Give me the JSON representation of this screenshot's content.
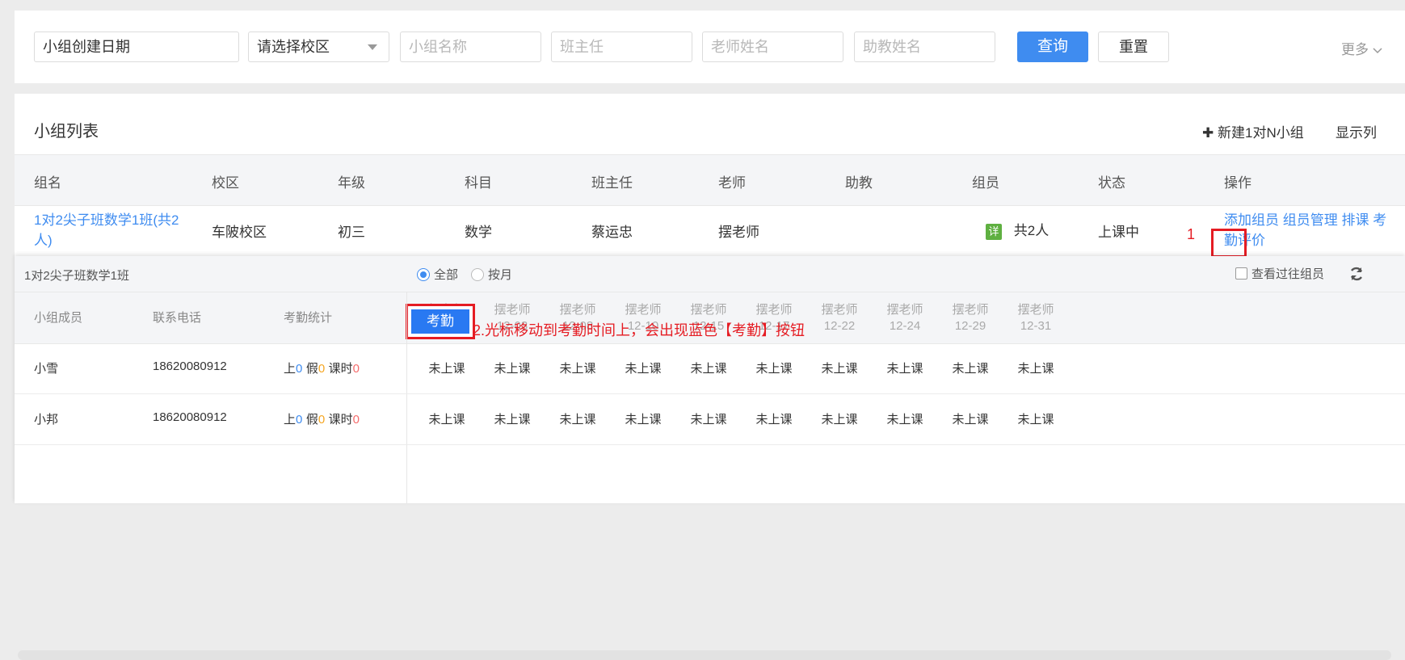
{
  "filters": {
    "created_date": "小组创建日期",
    "campus_select": "请选择校区",
    "group_name_ph": "小组名称",
    "head_teacher_ph": "班主任",
    "teacher_name_ph": "老师姓名",
    "assistant_name_ph": "助教姓名",
    "query_label": "查询",
    "reset_label": "重置",
    "more_label": "更多"
  },
  "panel": {
    "title": "小组列表",
    "new_group_label": "新建1对N小组",
    "display_columns_label": "显示列"
  },
  "table": {
    "headers": [
      "组名",
      "校区",
      "年级",
      "科目",
      "班主任",
      "老师",
      "助教",
      "组员",
      "状态",
      "操作"
    ],
    "row": {
      "group_name_line1": "1对2尖子班数学1班(共2",
      "group_name_line2": "人)",
      "campus": "车陂校区",
      "grade": "初三",
      "subject": "数学",
      "head_teacher": "蔡运忠",
      "teacher": "摆老师",
      "assistant": "",
      "detail_tag": "详",
      "members": "共2人",
      "status": "上课中",
      "ops": {
        "add_member": "添加组员",
        "manage_members": "组员管理",
        "schedule": "排课",
        "attend_part1": "考",
        "attend_part2": "勤",
        "evaluate": "评价"
      }
    }
  },
  "annotations": {
    "step1": "1",
    "step2": "2.光标移动到考勤时间上，会出现蓝色【考勤】按钮"
  },
  "sub_panel": {
    "group_title": "1对2尖子班数学1班",
    "radio_all": "全部",
    "radio_month": "按月",
    "past_members_label": "查看过往组员",
    "headers": {
      "member": "小组成员",
      "phone": "联系电话",
      "stats": "考勤统计"
    },
    "attend_button": "考勤",
    "dates": [
      {
        "teacher": "摆老师",
        "date": "12-01"
      },
      {
        "teacher": "摆老师",
        "date": "12-03"
      },
      {
        "teacher": "摆老师",
        "date": "12-08"
      },
      {
        "teacher": "摆老师",
        "date": "12-10"
      },
      {
        "teacher": "摆老师",
        "date": "12-15"
      },
      {
        "teacher": "摆老师",
        "date": "12-17"
      },
      {
        "teacher": "摆老师",
        "date": "12-22"
      },
      {
        "teacher": "摆老师",
        "date": "12-24"
      },
      {
        "teacher": "摆老师",
        "date": "12-29"
      },
      {
        "teacher": "摆老师",
        "date": "12-31"
      }
    ],
    "rows": [
      {
        "name": "小雪",
        "phone": "18620080912",
        "stat_attend_label": "上",
        "stat_attend": "0",
        "stat_leave_label": "假",
        "stat_leave": "0",
        "stat_hours_label": "课时",
        "stat_hours": "0",
        "cells": [
          "未上课",
          "未上课",
          "未上课",
          "未上课",
          "未上课",
          "未上课",
          "未上课",
          "未上课",
          "未上课",
          "未上课"
        ]
      },
      {
        "name": "小邦",
        "phone": "18620080912",
        "stat_attend_label": "上",
        "stat_attend": "0",
        "stat_leave_label": "假",
        "stat_leave": "0",
        "stat_hours_label": "课时",
        "stat_hours": "0",
        "cells": [
          "未上课",
          "未上课",
          "未上课",
          "未上课",
          "未上课",
          "未上课",
          "未上课",
          "未上课",
          "未上课",
          "未上课"
        ]
      }
    ]
  },
  "colors": {
    "primary": "#3f8cf0",
    "annotation_red": "#e51c23",
    "tag_green": "#5fb041"
  }
}
